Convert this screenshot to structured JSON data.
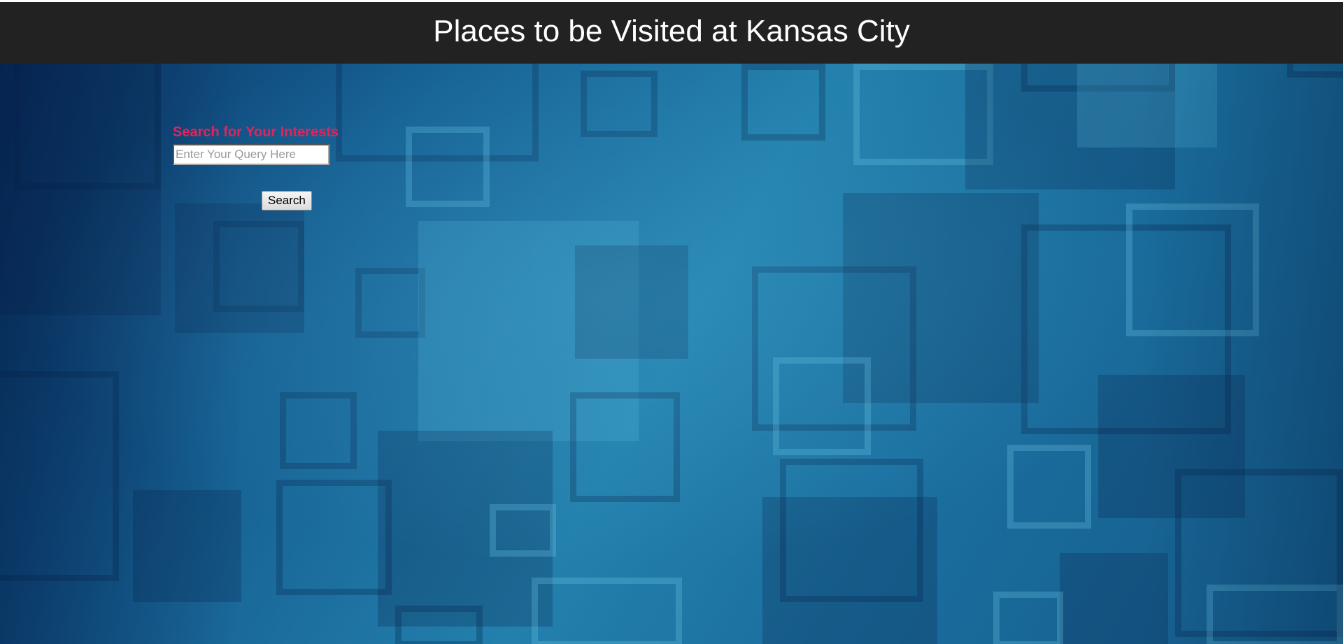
{
  "header": {
    "title": "Places to be Visited at Kansas City"
  },
  "search": {
    "heading": "Search for Your Interests",
    "placeholder": "Enter Your Query Here",
    "value": "",
    "button_label": "Search"
  },
  "colors": {
    "header_bg": "#222222",
    "header_text": "#ffffff",
    "heading_accent": "#e0245e",
    "background_theme": "#1a6e9e"
  }
}
